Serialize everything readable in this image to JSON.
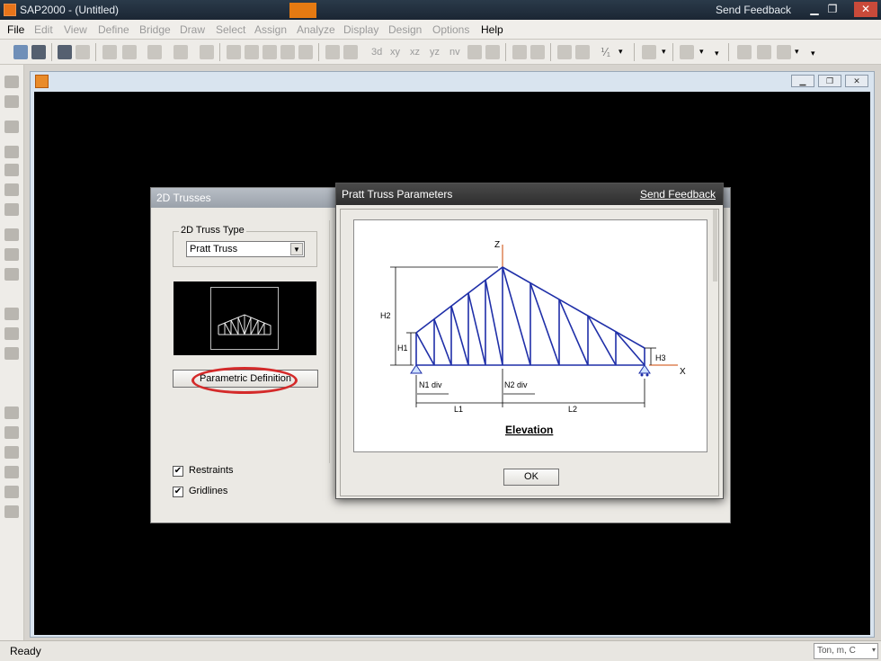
{
  "window": {
    "title": "SAP2000 - (Untitled)",
    "feedback": "Send Feedback"
  },
  "menu": [
    {
      "label": "File",
      "enabled": true
    },
    {
      "label": "Edit",
      "enabled": false
    },
    {
      "label": "View",
      "enabled": false
    },
    {
      "label": "Define",
      "enabled": false
    },
    {
      "label": "Bridge",
      "enabled": false
    },
    {
      "label": "Draw",
      "enabled": false
    },
    {
      "label": "Select",
      "enabled": false
    },
    {
      "label": "Assign",
      "enabled": false
    },
    {
      "label": "Analyze",
      "enabled": false
    },
    {
      "label": "Display",
      "enabled": false
    },
    {
      "label": "Design",
      "enabled": false
    },
    {
      "label": "Options",
      "enabled": false
    },
    {
      "label": "Help",
      "enabled": true
    }
  ],
  "toolbar": {
    "view_labels": [
      "3d",
      "xy",
      "xz",
      "yz",
      "nv"
    ],
    "dropdown_symbol": "⅟₁"
  },
  "trusses_dialog": {
    "title": "2D Trusses",
    "group_label": "2D Truss Type",
    "truss_type": "Pratt Truss",
    "param_button": "Parametric Definition",
    "restraints": "Restraints",
    "gridlines": "Gridlines",
    "restraints_checked": true,
    "gridlines_checked": true
  },
  "pratt_dialog": {
    "title": "Pratt Truss Parameters",
    "feedback": "Send Feedback",
    "ok": "OK",
    "diagram": {
      "axis_z": "Z",
      "axis_x": "X",
      "h1": "H1",
      "h2": "H2",
      "h3": "H3",
      "n1": "N1 div",
      "n2": "N2 div",
      "l1": "L1",
      "l2": "L2",
      "caption": "Elevation"
    }
  },
  "status": {
    "left": "Ready",
    "units": "Ton, m, C"
  },
  "colors": {
    "accent": "#e57a12",
    "truss": "#1f2fa8",
    "ring": "#d42a2a"
  }
}
